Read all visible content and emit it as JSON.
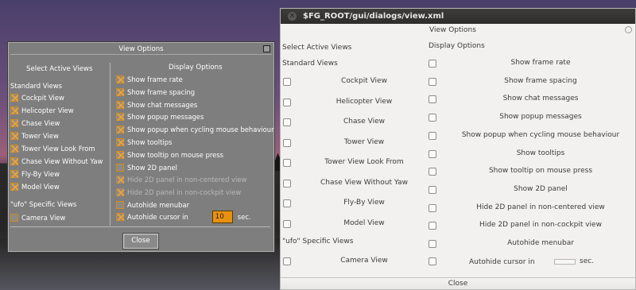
{
  "fg_dialog": {
    "title": "View Options",
    "left_heading": "Select Active Views",
    "right_heading": "Display Options",
    "standard_views_label": "Standard Views",
    "standard_views": [
      {
        "label": "Cockpit View",
        "checked": true
      },
      {
        "label": "Helicopter View",
        "checked": true
      },
      {
        "label": "Chase View",
        "checked": true
      },
      {
        "label": "Tower View",
        "checked": true
      },
      {
        "label": "Tower View Look From",
        "checked": true
      },
      {
        "label": "Chase View Without Yaw",
        "checked": true
      },
      {
        "label": "Fly-By View",
        "checked": true
      },
      {
        "label": "Model View",
        "checked": true
      }
    ],
    "ufo_views_label": "\"ufo\" Specific Views",
    "ufo_views": [
      {
        "label": "Camera View",
        "checked": false
      }
    ],
    "display_options": [
      {
        "label": "Show frame rate",
        "checked": true,
        "enabled": true
      },
      {
        "label": "Show frame spacing",
        "checked": true,
        "enabled": true
      },
      {
        "label": "Show chat messages",
        "checked": true,
        "enabled": true
      },
      {
        "label": "Show popup messages",
        "checked": true,
        "enabled": true
      },
      {
        "label": "Show popup when cycling mouse behaviour",
        "checked": true,
        "enabled": true
      },
      {
        "label": "Show tooltips",
        "checked": true,
        "enabled": true
      },
      {
        "label": "Show tooltip on mouse press",
        "checked": true,
        "enabled": true
      },
      {
        "label": "Show 2D panel",
        "checked": false,
        "enabled": true
      },
      {
        "label": "Hide 2D panel in non-centered view",
        "checked": true,
        "enabled": false
      },
      {
        "label": "Hide 2D panel in non-cockpit view",
        "checked": true,
        "enabled": false
      },
      {
        "label": "Autohide menubar",
        "checked": false,
        "enabled": true
      }
    ],
    "autohide_cursor_label": "Autohide cursor in",
    "autohide_cursor_value": "10",
    "autohide_cursor_unit": "sec.",
    "close_label": "Close",
    "accent_color": "#e8910e"
  },
  "gtk_window": {
    "window_title": "$FG_ROOT/gui/dialogs/view.xml",
    "close_icon": "close-icon",
    "title": "View Options",
    "left_heading": "Select Active Views",
    "right_heading": "Display Options",
    "standard_views_label": "Standard Views",
    "standard_views": [
      "Cockpit View",
      "Helicopter View",
      "Chase View",
      "Tower View",
      "Tower View Look From",
      "Chase View Without Yaw",
      "Fly-By View",
      "Model View"
    ],
    "ufo_views_label": "\"ufo\" Specific Views",
    "ufo_views": [
      "Camera View"
    ],
    "display_options": [
      "Show frame rate",
      "Show frame spacing",
      "Show chat messages",
      "Show popup messages",
      "Show popup when cycling mouse behaviour",
      "Show tooltips",
      "Show tooltip on mouse press",
      "Show 2D panel",
      "Hide 2D panel in non-centered view",
      "Hide 2D panel in non-cockpit view",
      "Autohide menubar"
    ],
    "autohide_cursor_label": "Autohide cursor in",
    "autohide_cursor_unit": "sec.",
    "close_label": "Close"
  }
}
